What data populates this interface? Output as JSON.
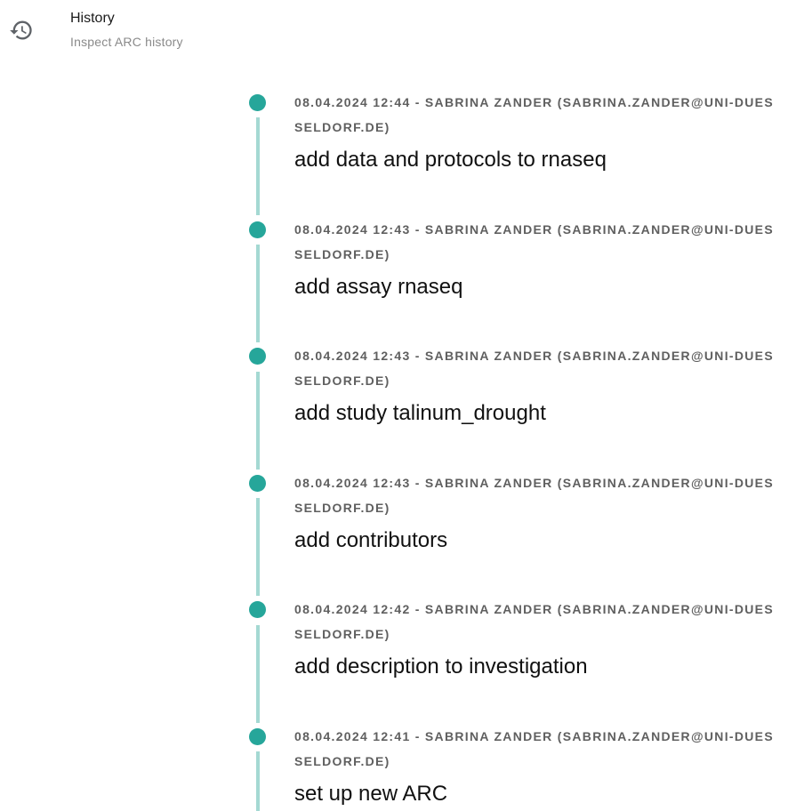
{
  "header": {
    "icon": "history-icon",
    "title": "History",
    "subtitle": "Inspect ARC history"
  },
  "colors": {
    "timeline_line": "#a4d9d3",
    "timeline_dot": "#26a69a",
    "meta_text": "#5f5f5f"
  },
  "entries": [
    {
      "meta": "08.04.2024 12:44 - SABRINA ZANDER (SABRINA.ZANDER@UNI-DUESSELDORF.DE)",
      "message": "add data and protocols to rnaseq"
    },
    {
      "meta": "08.04.2024 12:43 - SABRINA ZANDER (SABRINA.ZANDER@UNI-DUESSELDORF.DE)",
      "message": "add assay rnaseq"
    },
    {
      "meta": "08.04.2024 12:43 - SABRINA ZANDER (SABRINA.ZANDER@UNI-DUESSELDORF.DE)",
      "message": "add study talinum_drought"
    },
    {
      "meta": "08.04.2024 12:43 - SABRINA ZANDER (SABRINA.ZANDER@UNI-DUESSELDORF.DE)",
      "message": "add contributors"
    },
    {
      "meta": "08.04.2024 12:42 - SABRINA ZANDER (SABRINA.ZANDER@UNI-DUESSELDORF.DE)",
      "message": "add description to investigation"
    },
    {
      "meta": "08.04.2024 12:41 - SABRINA ZANDER (SABRINA.ZANDER@UNI-DUESSELDORF.DE)",
      "message": "set up new ARC"
    }
  ]
}
